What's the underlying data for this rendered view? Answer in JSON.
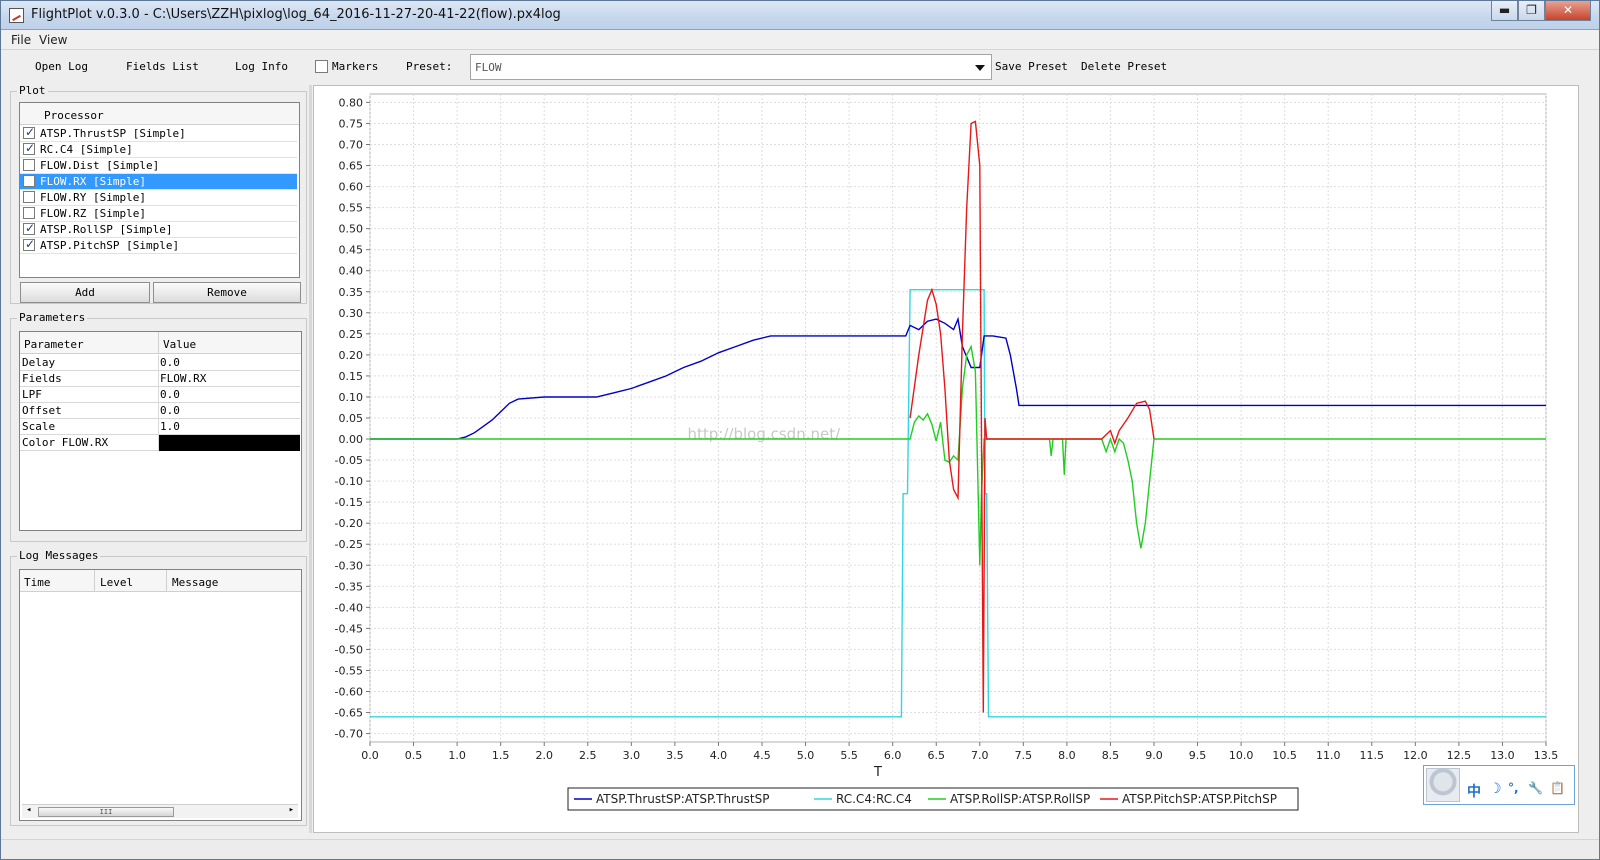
{
  "window": {
    "title": "FlightPlot v.0.3.0 - C:\\Users\\ZZH\\pixlog\\log_64_2016-11-27-20-41-22(flow).px4log",
    "minimize_label": "▬",
    "maximize_label": "❐",
    "close_label": "✕"
  },
  "menu": {
    "file": "File",
    "view": "View"
  },
  "toolbar": {
    "open_log": "Open Log",
    "fields_list": "Fields List",
    "log_info": "Log Info",
    "markers_label": "Markers",
    "markers_checked": false,
    "preset_label": "Preset:",
    "preset_value": "FLOW",
    "save_preset": "Save Preset",
    "delete_preset": "Delete Preset"
  },
  "plot_panel": {
    "title": "Plot",
    "column_header": "Processor",
    "processors": [
      {
        "label": "ATSP.ThrustSP [Simple]",
        "checked": true,
        "selected": false
      },
      {
        "label": "RC.C4 [Simple]",
        "checked": true,
        "selected": false
      },
      {
        "label": "FLOW.Dist [Simple]",
        "checked": false,
        "selected": false
      },
      {
        "label": "FLOW.RX [Simple]",
        "checked": false,
        "selected": true
      },
      {
        "label": "FLOW.RY [Simple]",
        "checked": false,
        "selected": false
      },
      {
        "label": "FLOW.RZ [Simple]",
        "checked": false,
        "selected": false
      },
      {
        "label": "ATSP.RollSP [Simple]",
        "checked": true,
        "selected": false
      },
      {
        "label": "ATSP.PitchSP [Simple]",
        "checked": true,
        "selected": false
      }
    ],
    "add_button": "Add",
    "remove_button": "Remove"
  },
  "parameters_panel": {
    "title": "Parameters",
    "col_parameter": "Parameter",
    "col_value": "Value",
    "rows": [
      {
        "name": "Delay",
        "value": "0.0"
      },
      {
        "name": "Fields",
        "value": "FLOW.RX"
      },
      {
        "name": "LPF",
        "value": "0.0"
      },
      {
        "name": "Offset",
        "value": "0.0"
      },
      {
        "name": "Scale",
        "value": "1.0"
      },
      {
        "name": "Color FLOW.RX",
        "value": ""
      }
    ],
    "color_value": "#000000"
  },
  "log_messages_panel": {
    "title": "Log Messages",
    "col_time": "Time",
    "col_level": "Level",
    "col_message": "Message",
    "scroll_thumb_grip": "III"
  },
  "ime_toolbar": {
    "glyph_zhong": "中",
    "glyph_moon": "☽",
    "glyph_dots": "°,",
    "glyph_wrench": "🔧",
    "glyph_clip": "📋"
  },
  "colors": {
    "thrust": "#0000c8",
    "rc": "#33d6e0",
    "roll": "#22cc22",
    "pitch": "#e81818",
    "grid": "#dddddd"
  },
  "chart_data": {
    "type": "line",
    "xlabel": "T",
    "ylabel": "",
    "xlim": [
      0.0,
      13.5
    ],
    "ylim": [
      -0.72,
      0.82
    ],
    "x_ticks": [
      0.0,
      0.5,
      1.0,
      1.5,
      2.0,
      2.5,
      3.0,
      3.5,
      4.0,
      4.5,
      5.0,
      5.5,
      6.0,
      6.5,
      7.0,
      7.5,
      8.0,
      8.5,
      9.0,
      9.5,
      10.0,
      10.5,
      11.0,
      11.5,
      12.0,
      12.5,
      13.0,
      13.5
    ],
    "x_tick_labels": [
      "0.0",
      "0.5",
      "1.0",
      "1.5",
      "2.0",
      "2.5",
      "3.0",
      "3.5",
      "4.0",
      "4.5",
      "5.0",
      "5.5",
      "6.0",
      "6.5",
      "7.0",
      "7.5",
      "8.0",
      "8.5",
      "9.0",
      "9.5",
      "10.0",
      "10.5",
      "11.0",
      "11.5",
      "12.0",
      "12.5",
      "13.0",
      "13.5"
    ],
    "y_ticks": [
      0.8,
      0.75,
      0.7,
      0.65,
      0.6,
      0.55,
      0.5,
      0.45,
      0.4,
      0.35,
      0.3,
      0.25,
      0.2,
      0.15,
      0.1,
      0.05,
      0.0,
      -0.05,
      -0.1,
      -0.15,
      -0.2,
      -0.25,
      -0.3,
      -0.35,
      -0.4,
      -0.45,
      -0.5,
      -0.55,
      -0.6,
      -0.65,
      -0.7
    ],
    "y_tick_labels": [
      "0.80",
      "0.75",
      "0.70",
      "0.65",
      "0.60",
      "0.55",
      "0.50",
      "0.45",
      "0.40",
      "0.35",
      "0.30",
      "0.25",
      "0.20",
      "0.15",
      "0.10",
      "0.05",
      "0.00",
      "-0.05",
      "-0.10",
      "-0.15",
      "-0.20",
      "-0.25",
      "-0.30",
      "-0.35",
      "-0.40",
      "-0.45",
      "-0.50",
      "-0.55",
      "-0.60",
      "-0.65",
      "-0.70"
    ],
    "grid": true,
    "legend_position": "bottom-center",
    "watermark": "http://blog.csdn.net/",
    "series": [
      {
        "name": "ATSP.ThrustSP:ATSP.ThrustSP",
        "color": "#0000c8",
        "points": [
          [
            0,
            0
          ],
          [
            1.0,
            0
          ],
          [
            1.1,
            0.005
          ],
          [
            1.2,
            0.015
          ],
          [
            1.3,
            0.03
          ],
          [
            1.4,
            0.045
          ],
          [
            1.5,
            0.065
          ],
          [
            1.6,
            0.085
          ],
          [
            1.7,
            0.095
          ],
          [
            2.0,
            0.1
          ],
          [
            2.3,
            0.1
          ],
          [
            2.6,
            0.1
          ],
          [
            2.8,
            0.11
          ],
          [
            3.0,
            0.12
          ],
          [
            3.2,
            0.135
          ],
          [
            3.4,
            0.15
          ],
          [
            3.6,
            0.17
          ],
          [
            3.8,
            0.185
          ],
          [
            4.0,
            0.205
          ],
          [
            4.2,
            0.22
          ],
          [
            4.4,
            0.235
          ],
          [
            4.6,
            0.245
          ],
          [
            5.0,
            0.245
          ],
          [
            5.5,
            0.245
          ],
          [
            6.0,
            0.245
          ],
          [
            6.15,
            0.245
          ],
          [
            6.2,
            0.27
          ],
          [
            6.3,
            0.26
          ],
          [
            6.4,
            0.28
          ],
          [
            6.5,
            0.285
          ],
          [
            6.6,
            0.275
          ],
          [
            6.7,
            0.26
          ],
          [
            6.75,
            0.285
          ],
          [
            6.8,
            0.22
          ],
          [
            6.9,
            0.17
          ],
          [
            7.0,
            0.17
          ],
          [
            7.05,
            0.245
          ],
          [
            7.15,
            0.245
          ],
          [
            7.3,
            0.24
          ],
          [
            7.35,
            0.2
          ],
          [
            7.42,
            0.12
          ],
          [
            7.45,
            0.08
          ],
          [
            8.0,
            0.08
          ],
          [
            9.0,
            0.08
          ],
          [
            10.0,
            0.08
          ],
          [
            11.0,
            0.08
          ],
          [
            12.0,
            0.08
          ],
          [
            13.0,
            0.08
          ],
          [
            13.5,
            0.08
          ]
        ]
      },
      {
        "name": "RC.C4:RC.C4",
        "color": "#33d6e0",
        "points": [
          [
            0,
            -0.66
          ],
          [
            6.1,
            -0.66
          ],
          [
            6.12,
            -0.13
          ],
          [
            6.17,
            -0.13
          ],
          [
            6.2,
            0.355
          ],
          [
            7.0,
            0.355
          ],
          [
            7.05,
            0.355
          ],
          [
            7.06,
            -0.13
          ],
          [
            7.08,
            -0.13
          ],
          [
            7.1,
            -0.66
          ],
          [
            13.5,
            -0.66
          ]
        ]
      },
      {
        "name": "ATSP.RollSP:ATSP.RollSP",
        "color": "#22cc22",
        "points": [
          [
            0,
            0
          ],
          [
            6.2,
            0
          ],
          [
            6.25,
            0.04
          ],
          [
            6.3,
            0.055
          ],
          [
            6.35,
            0.045
          ],
          [
            6.4,
            0.06
          ],
          [
            6.45,
            0.035
          ],
          [
            6.5,
            -0.005
          ],
          [
            6.55,
            0.04
          ],
          [
            6.6,
            -0.05
          ],
          [
            6.65,
            -0.055
          ],
          [
            6.7,
            -0.04
          ],
          [
            6.75,
            -0.05
          ],
          [
            6.8,
            0.12
          ],
          [
            6.85,
            0.2
          ],
          [
            6.9,
            0.22
          ],
          [
            6.95,
            0.16
          ],
          [
            7.0,
            -0.3
          ],
          [
            7.02,
            -0.13
          ],
          [
            7.05,
            0
          ],
          [
            7.8,
            0
          ],
          [
            7.82,
            -0.04
          ],
          [
            7.84,
            0
          ],
          [
            7.95,
            0
          ],
          [
            7.97,
            -0.085
          ],
          [
            7.99,
            0
          ],
          [
            8.4,
            0
          ],
          [
            8.45,
            -0.03
          ],
          [
            8.5,
            0
          ],
          [
            8.55,
            -0.03
          ],
          [
            8.6,
            0
          ],
          [
            8.65,
            -0.01
          ],
          [
            8.7,
            -0.05
          ],
          [
            8.75,
            -0.1
          ],
          [
            8.8,
            -0.2
          ],
          [
            8.85,
            -0.26
          ],
          [
            8.9,
            -0.2
          ],
          [
            8.95,
            -0.1
          ],
          [
            9.0,
            0
          ],
          [
            13.5,
            0
          ]
        ]
      },
      {
        "name": "ATSP.PitchSP:ATSP.PitchSP",
        "color": "#e81818",
        "points": [
          [
            6.2,
            0.05
          ],
          [
            6.3,
            0.2
          ],
          [
            6.4,
            0.33
          ],
          [
            6.45,
            0.355
          ],
          [
            6.5,
            0.32
          ],
          [
            6.55,
            0.25
          ],
          [
            6.6,
            0.12
          ],
          [
            6.65,
            -0.05
          ],
          [
            6.7,
            -0.12
          ],
          [
            6.75,
            -0.14
          ],
          [
            6.8,
            0.25
          ],
          [
            6.85,
            0.55
          ],
          [
            6.9,
            0.75
          ],
          [
            6.95,
            0.755
          ],
          [
            7.0,
            0.65
          ],
          [
            7.02,
            0.0
          ],
          [
            7.04,
            -0.65
          ],
          [
            7.06,
            0.05
          ],
          [
            7.08,
            0
          ],
          [
            8.4,
            0
          ],
          [
            8.5,
            0.02
          ],
          [
            8.55,
            -0.01
          ],
          [
            8.6,
            0.02
          ],
          [
            8.7,
            0.05
          ],
          [
            8.8,
            0.085
          ],
          [
            8.9,
            0.09
          ],
          [
            8.95,
            0.07
          ],
          [
            9.0,
            0
          ]
        ]
      }
    ]
  }
}
